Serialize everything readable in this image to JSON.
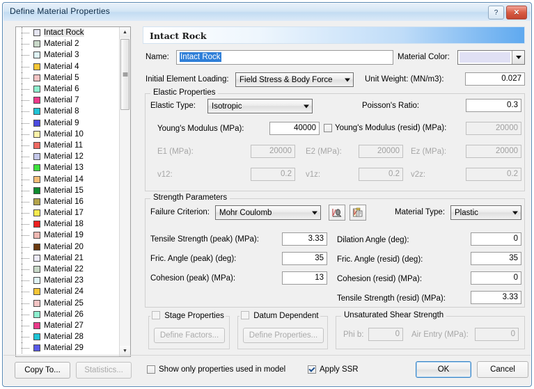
{
  "window": {
    "title": "Define Material Properties",
    "help_button": "?",
    "close_button": "✕"
  },
  "tree": {
    "items": [
      {
        "label": "Intact Rock",
        "color": "#e6e6f2",
        "selected": true
      },
      {
        "label": "Material 2",
        "color": "#c8d8c8",
        "selected": false
      },
      {
        "label": "Material 3",
        "color": "#dff4f6",
        "selected": false
      },
      {
        "label": "Material 4",
        "color": "#f5c636",
        "selected": false
      },
      {
        "label": "Material 5",
        "color": "#f4c4c4",
        "selected": false
      },
      {
        "label": "Material 6",
        "color": "#8ef0cf",
        "selected": false
      },
      {
        "label": "Material 7",
        "color": "#ec3a8a",
        "selected": false
      },
      {
        "label": "Material 8",
        "color": "#1fc4d6",
        "selected": false
      },
      {
        "label": "Material 9",
        "color": "#4a4ae0",
        "selected": false
      },
      {
        "label": "Material 10",
        "color": "#fdf3a8",
        "selected": false
      },
      {
        "label": "Material 11",
        "color": "#ef6a62",
        "selected": false
      },
      {
        "label": "Material 12",
        "color": "#c4c8ea",
        "selected": false
      },
      {
        "label": "Material 13",
        "color": "#3ee23e",
        "selected": false
      },
      {
        "label": "Material 14",
        "color": "#f5bd78",
        "selected": false
      },
      {
        "label": "Material 15",
        "color": "#0f8a2e",
        "selected": false
      },
      {
        "label": "Material 16",
        "color": "#b3a34a",
        "selected": false
      },
      {
        "label": "Material 17",
        "color": "#f6ea4e",
        "selected": false
      },
      {
        "label": "Material 18",
        "color": "#ec2020",
        "selected": false
      },
      {
        "label": "Material 19",
        "color": "#eeb8b2",
        "selected": false
      },
      {
        "label": "Material 20",
        "color": "#6b3a10",
        "selected": false
      },
      {
        "label": "Material 21",
        "color": "#eceaf8",
        "selected": false
      },
      {
        "label": "Material 22",
        "color": "#c8d8c8",
        "selected": false
      },
      {
        "label": "Material 23",
        "color": "#dff4f6",
        "selected": false
      },
      {
        "label": "Material 24",
        "color": "#f5c636",
        "selected": false
      },
      {
        "label": "Material 25",
        "color": "#f4c4c4",
        "selected": false
      },
      {
        "label": "Material 26",
        "color": "#8ef0cf",
        "selected": false
      },
      {
        "label": "Material 27",
        "color": "#ec3a8a",
        "selected": false
      },
      {
        "label": "Material 28",
        "color": "#1fc4d6",
        "selected": false
      },
      {
        "label": "Material 29",
        "color": "#5a5ae8",
        "selected": false
      }
    ]
  },
  "header": {
    "banner_title": "Intact Rock",
    "name_label": "Name:",
    "name_value": "Intact Rock",
    "material_color_label": "Material Color:",
    "material_color_value": "#e0e0f4",
    "initial_loading_label": "Initial Element Loading:",
    "initial_loading_value": "Field Stress & Body Force",
    "unit_weight_label": "Unit Weight: (MN/m3):",
    "unit_weight_value": "0.027"
  },
  "elastic": {
    "group_title": "Elastic Properties",
    "elastic_type_label": "Elastic Type:",
    "elastic_type_value": "Isotropic",
    "poissons_label": "Poisson's Ratio:",
    "poissons_value": "0.3",
    "youngs_label": "Young's Modulus (MPa):",
    "youngs_value": "40000",
    "youngs_resid_label": "Young's Modulus (resid) (MPa):",
    "youngs_resid_value": "20000",
    "youngs_resid_checked": false,
    "e1_label": "E1 (MPa):",
    "e1_value": "20000",
    "e2_label": "E2 (MPa):",
    "e2_value": "20000",
    "ez_label": "Ez (MPa):",
    "ez_value": "20000",
    "v12_label": "v12:",
    "v12_value": "0.2",
    "v1z_label": "v1z:",
    "v1z_value": "0.2",
    "v2z_label": "v2z:",
    "v2z_value": "0.2"
  },
  "strength": {
    "group_title": "Strength Parameters",
    "failure_criterion_label": "Failure Criterion:",
    "failure_criterion_value": "Mohr Coulomb",
    "material_type_label": "Material Type:",
    "material_type_value": "Plastic",
    "tensile_peak_label": "Tensile Strength (peak) (MPa):",
    "tensile_peak_value": "3.33",
    "dilation_label": "Dilation Angle (deg):",
    "dilation_value": "0",
    "fric_peak_label": "Fric. Angle (peak) (deg):",
    "fric_peak_value": "35",
    "fric_resid_label": "Fric. Angle (resid) (deg):",
    "fric_resid_value": "35",
    "cohesion_peak_label": "Cohesion (peak) (MPa):",
    "cohesion_peak_value": "13",
    "cohesion_resid_label": "Cohesion (resid) (MPa):",
    "cohesion_resid_value": "0",
    "tensile_resid_label": "Tensile Strength (resid) (MPa):",
    "tensile_resid_value": "3.33"
  },
  "bottom_groups": {
    "stage_properties_label": "Stage Properties",
    "stage_properties_checked": false,
    "define_factors_label": "Define Factors...",
    "datum_dependent_label": "Datum Dependent",
    "datum_dependent_checked": false,
    "define_properties_label": "Define Properties...",
    "unsaturated_title": "Unsaturated Shear Strength",
    "phi_b_label": "Phi b:",
    "phi_b_value": "0",
    "air_entry_label": "Air Entry (MPa):",
    "air_entry_value": "0"
  },
  "footer": {
    "copy_to_label": "Copy To...",
    "statistics_label": "Statistics...",
    "show_only_label": "Show only properties used in model",
    "show_only_checked": false,
    "apply_ssr_label": "Apply SSR",
    "apply_ssr_checked": true,
    "ok_label": "OK",
    "cancel_label": "Cancel"
  }
}
